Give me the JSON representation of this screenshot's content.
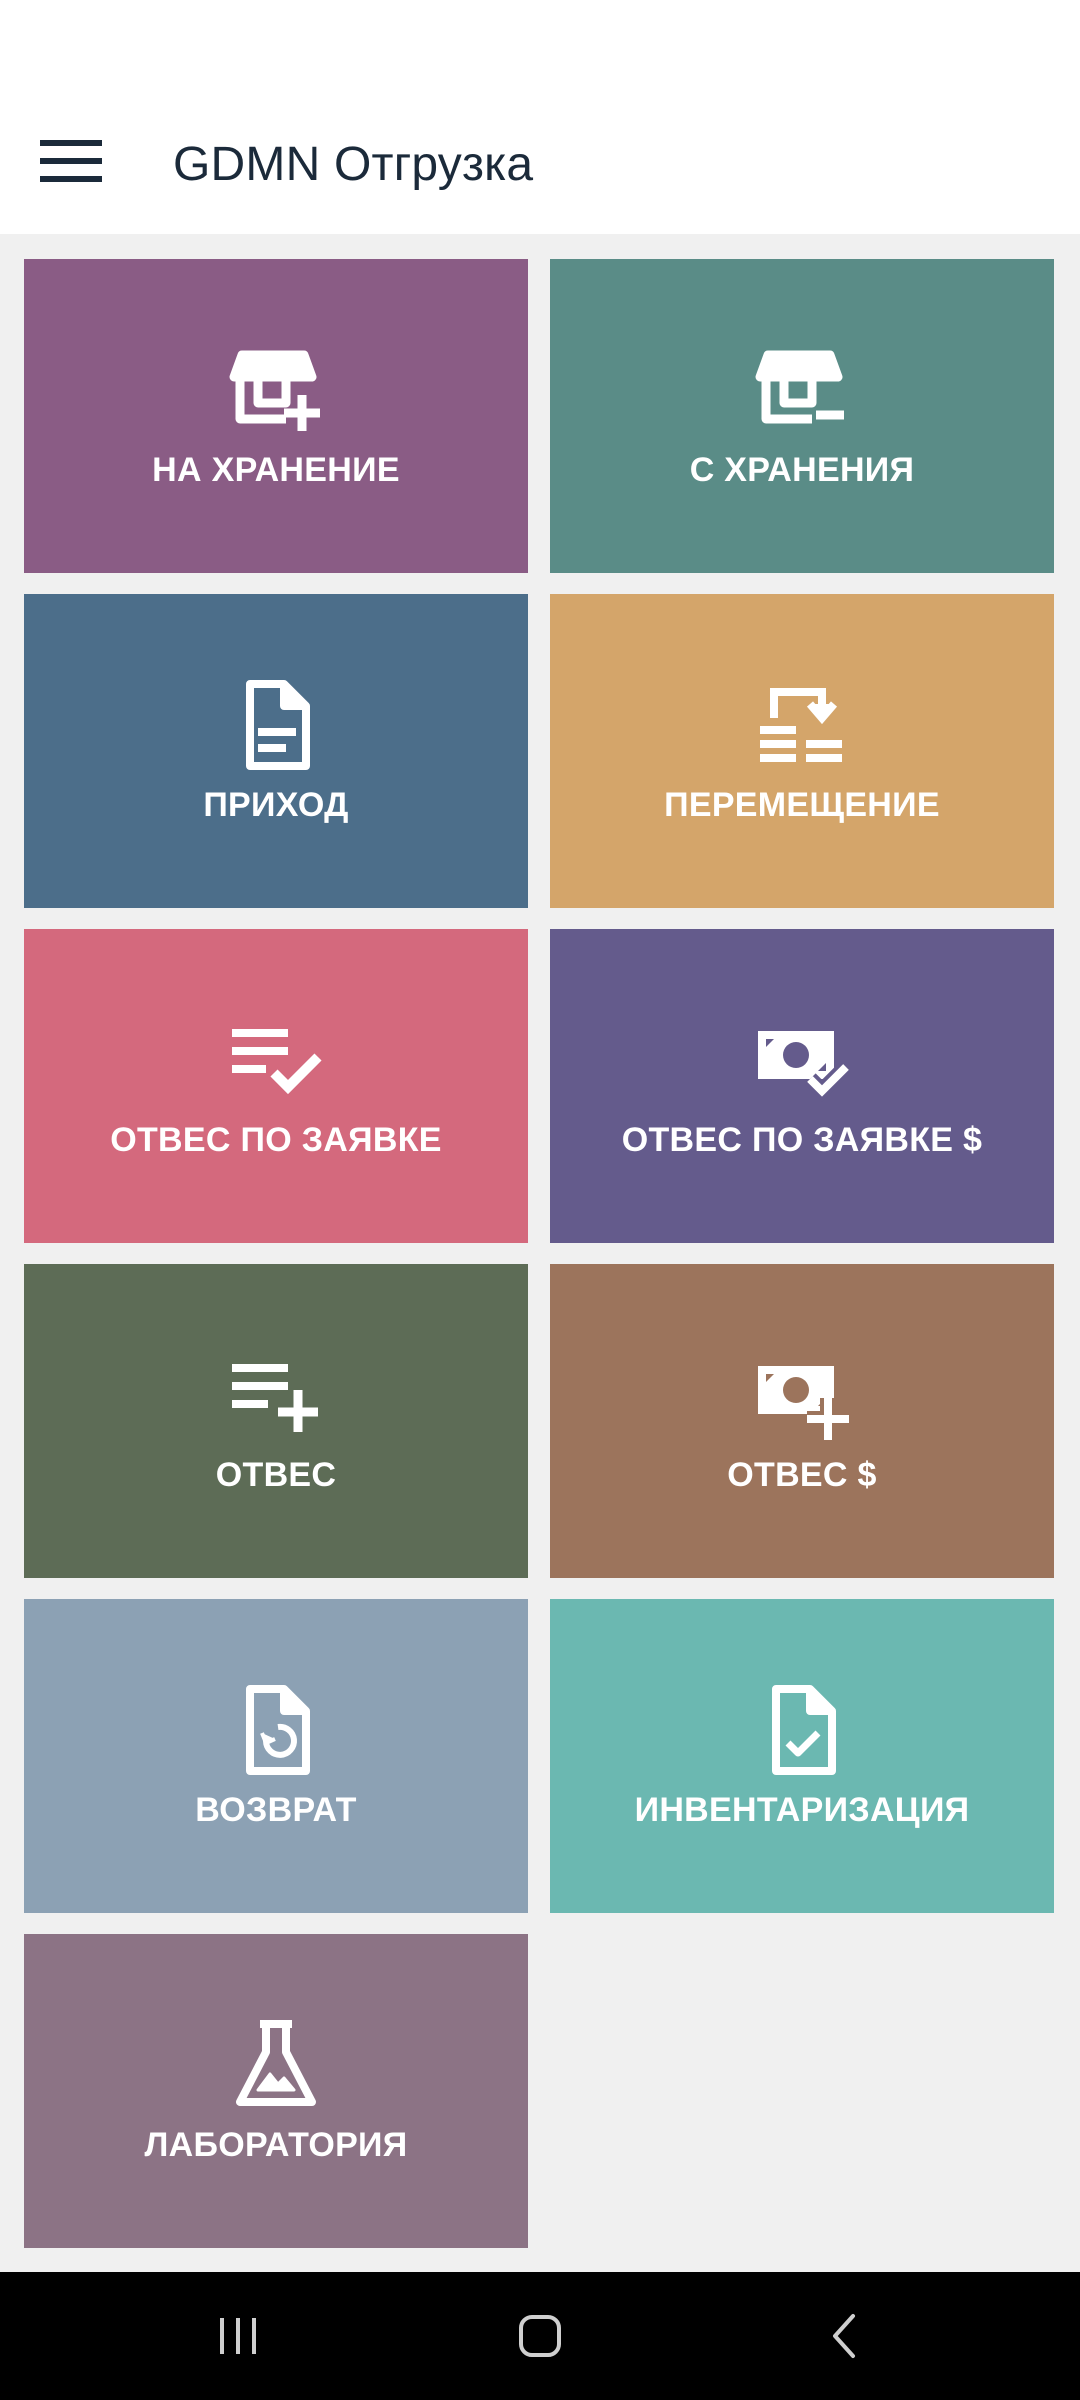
{
  "app_bar": {
    "title": "GDMN Отгрузка",
    "menu_icon": "hamburger-menu-icon"
  },
  "tiles": [
    {
      "label": "НА ХРАНЕНИЕ",
      "icon": "store-plus-icon",
      "color": "#8a5c85"
    },
    {
      "label": "С ХРАНЕНИЯ",
      "icon": "store-minus-icon",
      "color": "#5a8c87"
    },
    {
      "label": "ПРИХОД",
      "icon": "document-icon",
      "color": "#4c6e8a"
    },
    {
      "label": "ПЕРЕМЕЩЕНИЕ",
      "icon": "transfer-icon",
      "color": "#d4a56a"
    },
    {
      "label": "ОТВЕС ПО ЗАЯВКЕ",
      "icon": "list-check-icon",
      "color": "#d4697d"
    },
    {
      "label": "ОТВЕС ПО ЗАЯВКЕ $",
      "icon": "cash-check-icon",
      "color": "#645b8c"
    },
    {
      "label": "ОТВЕС",
      "icon": "list-plus-icon",
      "color": "#5d6c56"
    },
    {
      "label": "ОТВЕС $",
      "icon": "cash-plus-icon",
      "color": "#9c745c"
    },
    {
      "label": "ВОЗВРАТ",
      "icon": "document-restore-icon",
      "color": "#8ca1b4"
    },
    {
      "label": "ИНВЕНТАРИЗАЦИЯ",
      "icon": "document-check-icon",
      "color": "#6bb8b1"
    },
    {
      "label": "ЛАБОРАТОРИЯ",
      "icon": "flask-icon",
      "color": "#8c7385"
    }
  ],
  "system_nav": {
    "recents_icon": "recent-apps-icon",
    "home_icon": "home-icon",
    "back_icon": "back-icon"
  }
}
